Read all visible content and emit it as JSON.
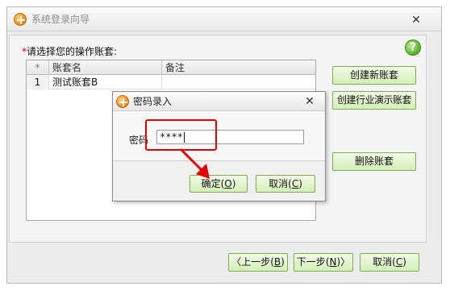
{
  "window": {
    "title": "系统登录向导",
    "close_glyph": "✕"
  },
  "prompt": {
    "required_mark": "*",
    "text": "请选择您的操作账套:"
  },
  "help": {
    "glyph": "?"
  },
  "grid": {
    "columns": [
      "*",
      "账套名",
      "备注"
    ],
    "rows": [
      {
        "index": "1",
        "name": "测试账套B",
        "note": ""
      }
    ]
  },
  "side_buttons": {
    "create_new": "创建新账套",
    "create_demo": "创建行业演示账套",
    "delete": "删除账套"
  },
  "footer": {
    "prev_text": "上一步",
    "prev_key": "B",
    "next_text": "下一步",
    "next_key": "N",
    "cancel_text": "取消",
    "cancel_key": "C"
  },
  "dialog": {
    "title": "密码录入",
    "close_glyph": "✕",
    "password_label": "密码",
    "password_value": "****",
    "ok_text": "确定",
    "ok_key": "O",
    "cancel_text": "取消",
    "cancel_key": "C"
  },
  "colors": {
    "annotation": "#e10000",
    "button_border": "#7cae54"
  }
}
